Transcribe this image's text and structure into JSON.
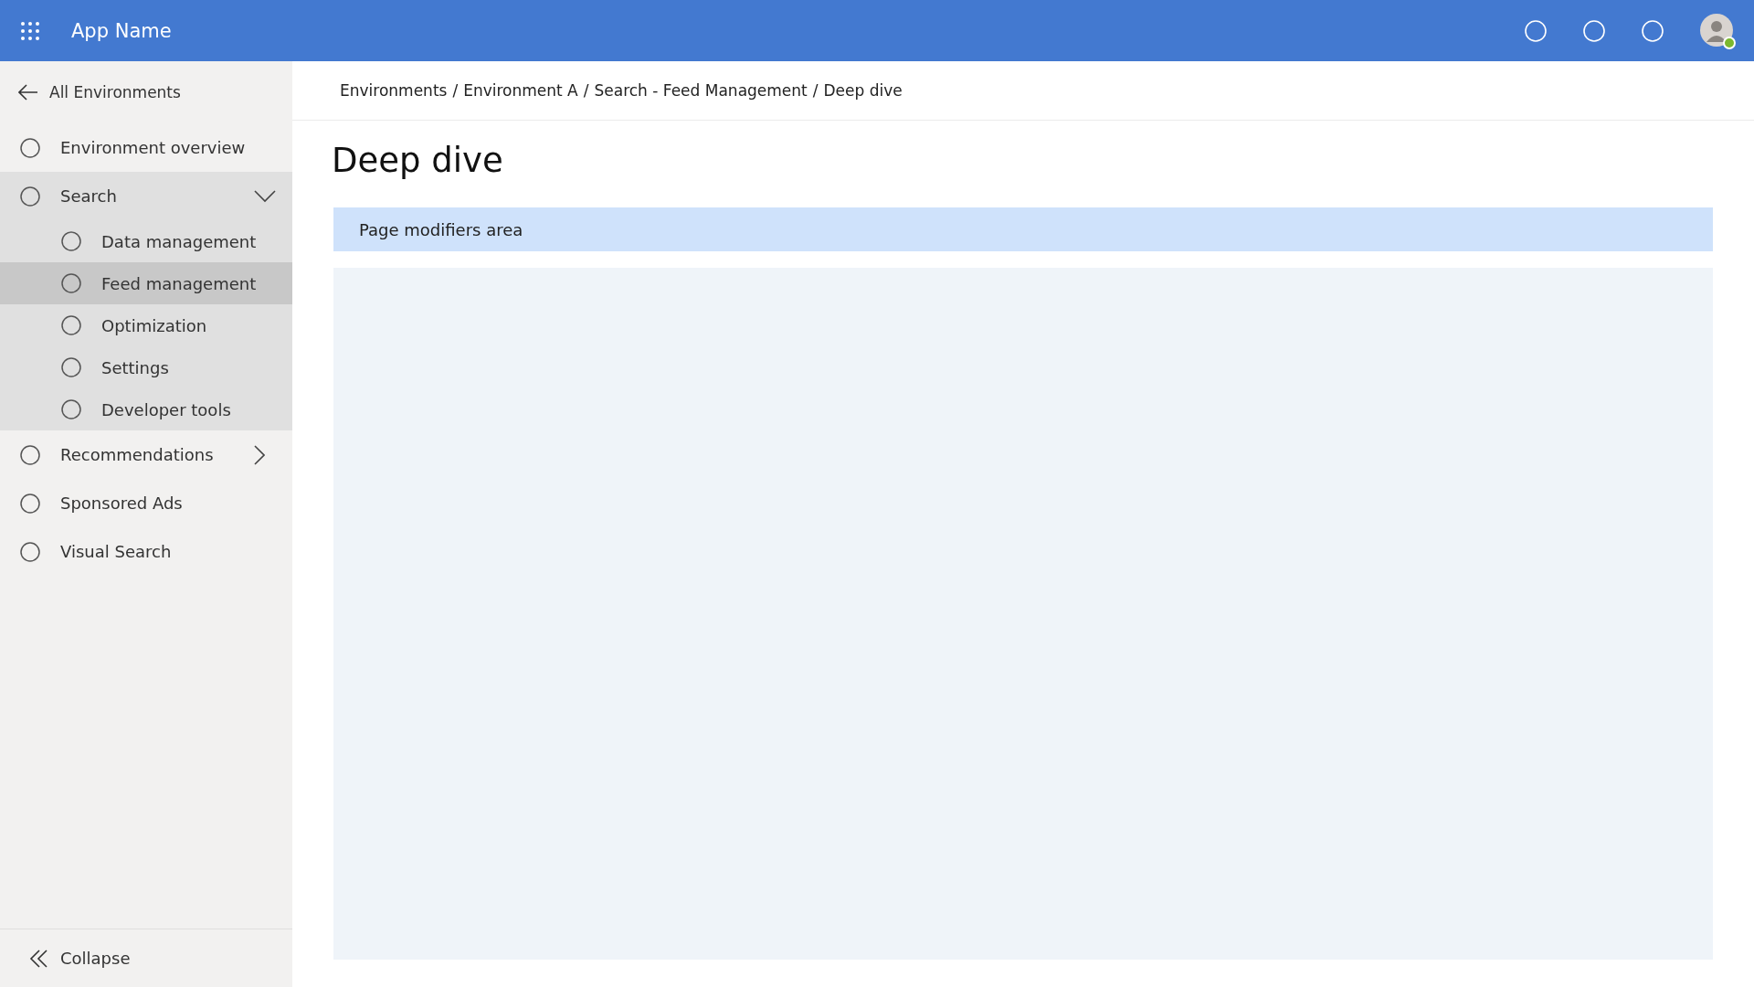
{
  "header": {
    "app_name": "App Name",
    "icon_buttons": [
      {
        "kind": "circle"
      },
      {
        "kind": "circle"
      },
      {
        "kind": "circle"
      }
    ]
  },
  "sidebar": {
    "back_link": "All Environments",
    "items": [
      {
        "label": "Environment overview",
        "kind": "link",
        "selected": false
      },
      {
        "label": "Search",
        "kind": "group",
        "expanded": true,
        "selected": false,
        "children": [
          {
            "label": "Data management",
            "selected": false
          },
          {
            "label": "Feed management",
            "selected": true
          },
          {
            "label": "Optimization",
            "selected": false
          },
          {
            "label": "Settings",
            "selected": false
          },
          {
            "label": "Developer tools",
            "selected": false
          }
        ]
      },
      {
        "label": "Recommendations",
        "kind": "group",
        "expanded": false,
        "selected": false
      },
      {
        "label": "Sponsored Ads",
        "kind": "link",
        "selected": false
      },
      {
        "label": "Visual Search",
        "kind": "link",
        "selected": false
      }
    ],
    "collapse": "Collapse"
  },
  "breadcrumb": {
    "separator": "/",
    "items": [
      "Environments",
      "Environment A",
      "Search - Feed Management",
      "Deep dive"
    ]
  },
  "page": {
    "title": "Deep dive",
    "modifiers_area": "Page modifiers area"
  }
}
